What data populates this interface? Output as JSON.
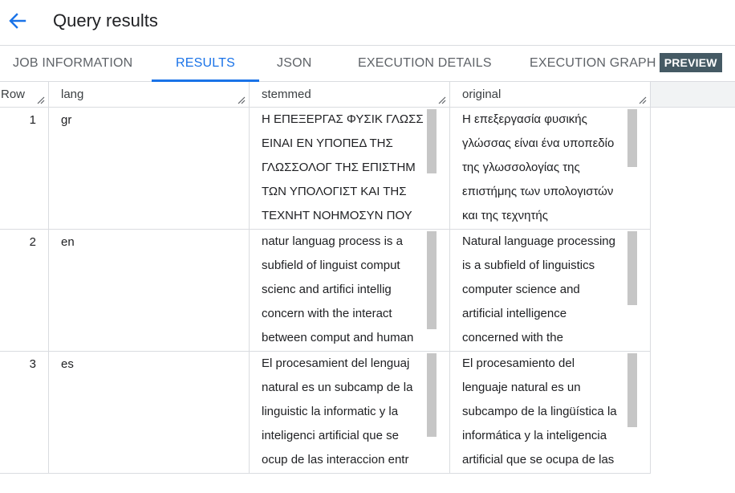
{
  "header": {
    "title": "Query results"
  },
  "tabs": [
    {
      "label": "JOB INFORMATION"
    },
    {
      "label": "RESULTS"
    },
    {
      "label": "JSON"
    },
    {
      "label": "EXECUTION DETAILS"
    },
    {
      "label": "EXECUTION GRAPH",
      "badge": "PREVIEW"
    }
  ],
  "table": {
    "columns": [
      "Row",
      "lang",
      "stemmed",
      "original"
    ],
    "rows": [
      {
        "row": "1",
        "lang": "gr",
        "stemmed": [
          "Η ΕΠΕΞΕΡΓΑΣ ΦΥΣΙΚ ΓΛΩΣΣ",
          "ΕΙΝΑΙ ΕΝ ΥΠΟΠΕΔ ΤΗΣ",
          "ΓΛΩΣΣΟΛΟΓ ΤΗΣ ΕΠΙΣΤΗΜ",
          "ΤΩΝ ΥΠΟΛΟΓΙΣΤ ΚΑΙ ΤΗΣ",
          "ΤΕΧΝΗΤ ΝΟΗΜΟΣΥΝ ΠΟΥ"
        ],
        "original": [
          "Η επεξεργασία φυσικής",
          "γλώσσας είναι ένα υποπεδίο",
          "της γλωσσολογίας της",
          "επιστήμης των υπολογιστών",
          "και της τεχνητής"
        ]
      },
      {
        "row": "2",
        "lang": "en",
        "stemmed": [
          "natur languag process is a",
          "subfield of linguist comput",
          "scienc and artifici intellig",
          "concern with the interact",
          "between comput and human"
        ],
        "original": [
          "Natural language processing",
          "is a subfield of linguistics",
          "computer science and",
          "artificial intelligence",
          "concerned with the"
        ]
      },
      {
        "row": "3",
        "lang": "es",
        "stemmed": [
          "El procesamient del lenguaj",
          "natural es un subcamp de la",
          "linguistic la informatic y la",
          "inteligenci artificial que se",
          "ocup de las interaccion entr"
        ],
        "original": [
          "El procesamiento del",
          "lenguaje natural es un",
          "subcampo de la lingüística la",
          "informática y la inteligencia",
          "artificial que se ocupa de las"
        ]
      }
    ]
  },
  "colors": {
    "accent": "#1a73e8",
    "badge_bg": "#455a64",
    "border": "#dadce0"
  }
}
